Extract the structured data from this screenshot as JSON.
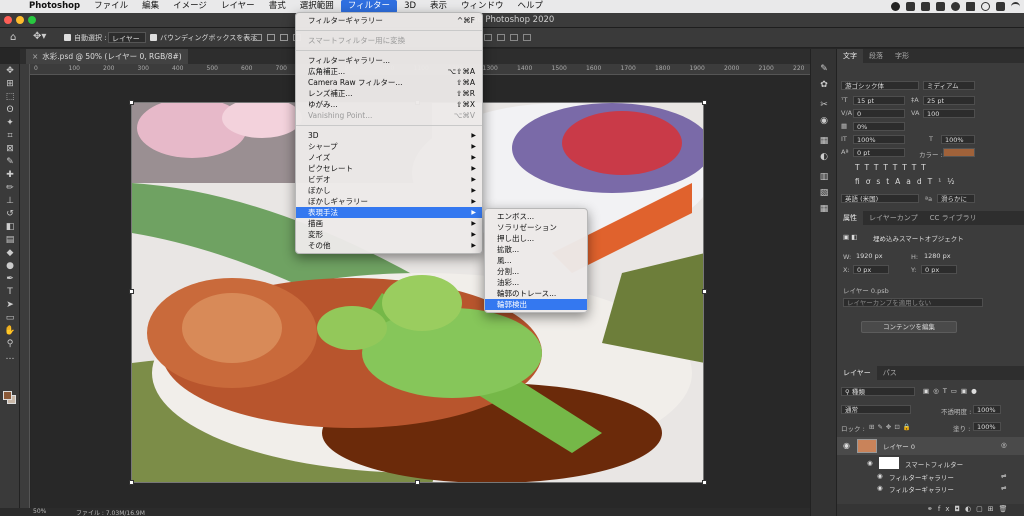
{
  "menubar": {
    "app": "Photoshop",
    "items": [
      "ファイル",
      "編集",
      "イメージ",
      "レイヤー",
      "書式",
      "選択範囲",
      "フィルター",
      "3D",
      "表示",
      "ウィンドウ",
      "ヘルプ"
    ],
    "active_index": 6
  },
  "window": {
    "title": "be Photoshop 2020"
  },
  "options": {
    "auto_select_label": "自動選択 :",
    "auto_select_value": "レイヤー",
    "bbox_label": "バウンディングボックスを表示"
  },
  "document": {
    "tab_title": "水彩.psd @ 50% (レイヤー 0, RGB/8#)",
    "close_glyph": "×",
    "ruler_ticks": [
      "0",
      "100",
      "200",
      "300",
      "400",
      "500",
      "600",
      "700",
      "800",
      "900",
      "1000",
      "1100",
      "1200",
      "1300",
      "1400",
      "1500",
      "1600",
      "1700",
      "1800",
      "1900",
      "2000",
      "2100",
      "220"
    ]
  },
  "status": {
    "zoom": "50%",
    "file_info": "ファイル : 7.03M/16.9M"
  },
  "filter_menu": {
    "items": [
      {
        "label": "フィルターギャラリー",
        "shortcut": "^⌘F"
      },
      {
        "sep": true
      },
      {
        "label": "スマートフィルター用に変換",
        "disabled": true
      },
      {
        "sep": true
      },
      {
        "label": "フィルターギャラリー..."
      },
      {
        "label": "広角補正...",
        "shortcut": "⌥⇧⌘A"
      },
      {
        "label": "Camera Raw フィルター...",
        "shortcut": "⇧⌘A"
      },
      {
        "label": "レンズ補正...",
        "shortcut": "⇧⌘R"
      },
      {
        "label": "ゆがみ...",
        "shortcut": "⇧⌘X"
      },
      {
        "label": "Vanishing Point...",
        "shortcut": "⌥⌘V",
        "disabled": true
      },
      {
        "sep": true
      },
      {
        "label": "3D",
        "sub": true
      },
      {
        "label": "シャープ",
        "sub": true
      },
      {
        "label": "ノイズ",
        "sub": true
      },
      {
        "label": "ピクセレート",
        "sub": true
      },
      {
        "label": "ビデオ",
        "sub": true
      },
      {
        "label": "ぼかし",
        "sub": true
      },
      {
        "label": "ぼかしギャラリー",
        "sub": true
      },
      {
        "label": "表現手法",
        "sub": true,
        "highlight": true
      },
      {
        "label": "描画",
        "sub": true
      },
      {
        "label": "変形",
        "sub": true
      },
      {
        "label": "その他",
        "sub": true
      }
    ]
  },
  "stylize_submenu": {
    "items": [
      {
        "label": "エンボス..."
      },
      {
        "label": "ソラリゼーション"
      },
      {
        "label": "押し出し..."
      },
      {
        "label": "拡散..."
      },
      {
        "label": "風..."
      },
      {
        "label": "分割..."
      },
      {
        "label": "油彩..."
      },
      {
        "label": "輪郭のトレース..."
      },
      {
        "label": "輪郭検出",
        "highlight": true
      }
    ]
  },
  "character_panel": {
    "tabs": [
      "文字",
      "段落",
      "字形"
    ],
    "font_family": "游ゴシック体",
    "font_style": "ミディアム",
    "size": "15 pt",
    "leading": "25 pt",
    "kerning": "0",
    "tracking": "100",
    "tsume": "0%",
    "vscale": "100%",
    "hscale": "100%",
    "baseline": "0 pt",
    "color_label": "カラー :",
    "color": "#a0623a",
    "language": "英語 (米国)",
    "antialias": "滑らかに"
  },
  "properties_panel": {
    "tabs": [
      "属性",
      "レイヤーカンプ",
      "CC ライブラリ"
    ],
    "object_type": "埋め込みスマートオブジェクト",
    "w": "1920 px",
    "h": "1280 px",
    "x": "0 px",
    "y": "0 px",
    "file": "レイヤー 0.psb",
    "comp_placeholder": "レイヤーカンプを適用しない",
    "edit_button": "コンテンツを編集"
  },
  "layers_panel": {
    "tabs": [
      "レイヤー",
      "パス"
    ],
    "kind": "種類",
    "blend": "通常",
    "opacity_label": "不透明度 :",
    "opacity": "100%",
    "lock_label": "ロック :",
    "fill_label": "塗り :",
    "fill": "100%",
    "layers": [
      {
        "name": "レイヤー 0"
      },
      {
        "name": "スマートフィルター"
      },
      {
        "name": "フィルターギャラリー"
      },
      {
        "name": "フィルターギャラリー"
      }
    ]
  }
}
